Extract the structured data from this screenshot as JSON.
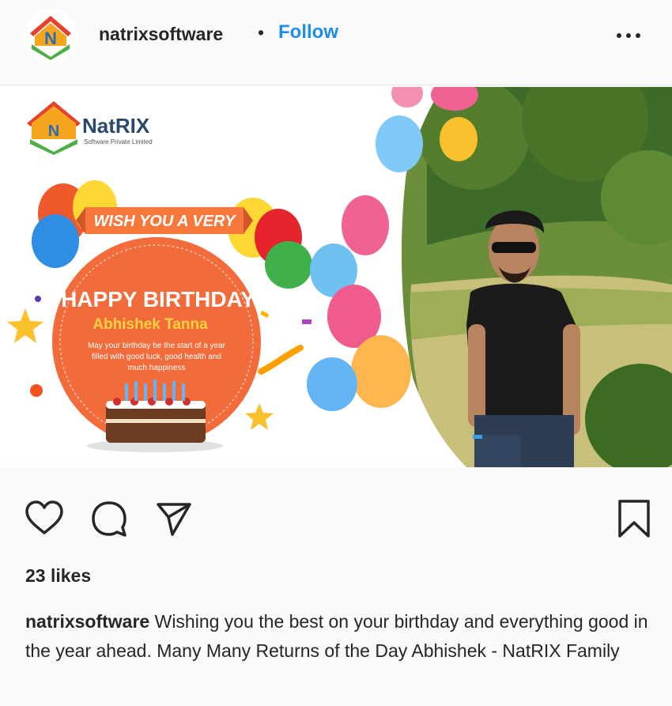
{
  "post": {
    "username": "natrixsoftware",
    "separator": "•",
    "follow_label": "Follow",
    "likes": "23 likes",
    "caption": "Wishing you the best on your birthday and everything good in the year ahead. Many Many Returns of the Day Abhishek - NatRIX Family"
  },
  "image": {
    "brand": "NatRIX",
    "brand_sub": "Software Private Limited",
    "banner": "WISH YOU A VERY",
    "headline": "HAPPY BIRTHDAY",
    "person_name": "Abhishek Tanna",
    "message_line1": "May your birthday be the start of a year",
    "message_line2": "filled with good luck, good health and",
    "message_line3": "much happiness"
  },
  "icons": {
    "like": "heart-icon",
    "comment": "comment-icon",
    "share": "send-icon",
    "save": "bookmark-icon",
    "more": "more-options-icon"
  },
  "colors": {
    "follow": "#1d8ee6",
    "circle": "#f26b3a",
    "banner": "#f6783d",
    "name": "#ffd23f"
  }
}
